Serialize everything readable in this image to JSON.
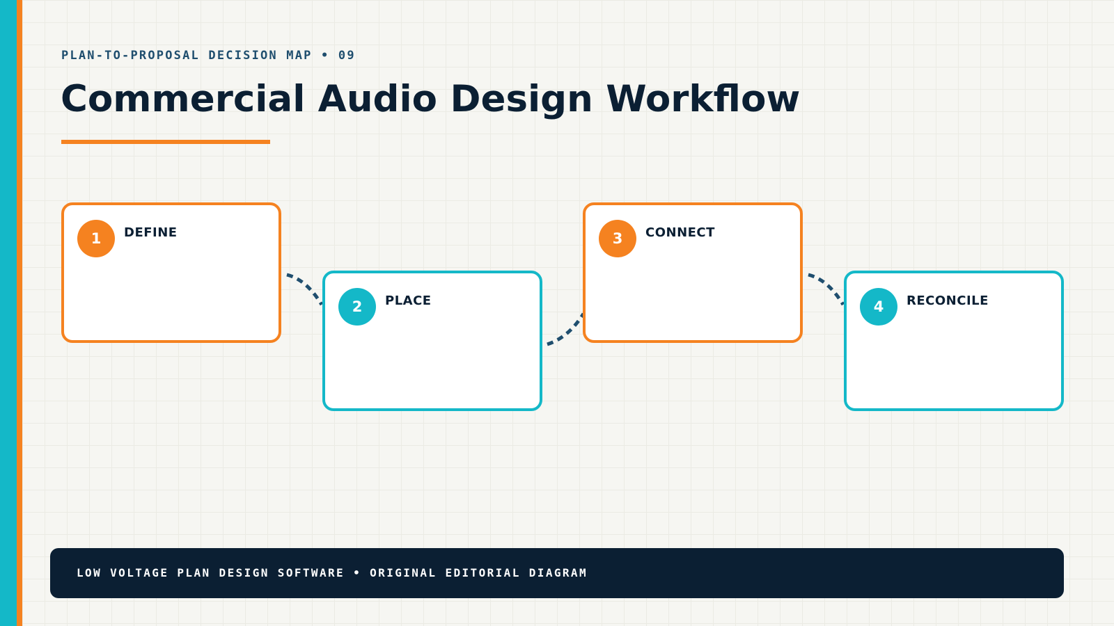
{
  "header": {
    "eyebrow": "PLAN-TO-PROPOSAL DECISION MAP • 09",
    "title": "Commercial Audio Design Workflow"
  },
  "steps": [
    {
      "number": "1",
      "label": "DEFINE",
      "accent": "#f58220"
    },
    {
      "number": "2",
      "label": "PLACE",
      "accent": "#14b8c8"
    },
    {
      "number": "3",
      "label": "CONNECT",
      "accent": "#f58220"
    },
    {
      "number": "4",
      "label": "RECONCILE",
      "accent": "#14b8c8"
    }
  ],
  "connector_style": "dashed",
  "footer": {
    "text": "LOW VOLTAGE PLAN DESIGN SOFTWARE • ORIGINAL EDITORIAL DIAGRAM"
  },
  "colors": {
    "navy": "#0b1f33",
    "orange": "#f58220",
    "teal": "#14b8c8",
    "background": "#f6f6f2",
    "connector": "#1f4e6e"
  }
}
